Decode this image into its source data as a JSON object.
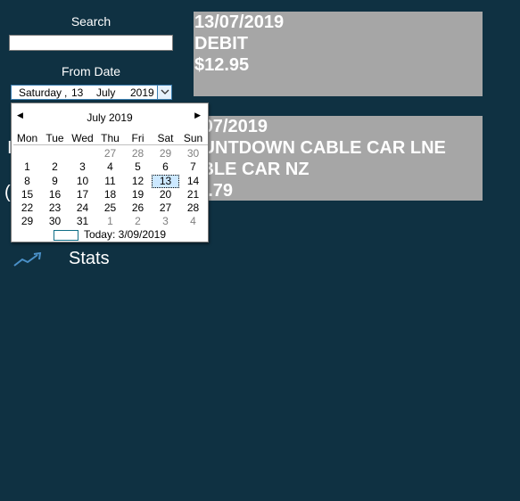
{
  "sidebar": {
    "search_label": "Search",
    "search_value": "",
    "from_date_label": "From Date",
    "date_picker": {
      "day_name": "Saturday",
      "separator": ",",
      "day": "13",
      "month": "July",
      "year": "2019"
    },
    "stats_label": "Stats",
    "hidden_fragments": [
      "I",
      "("
    ]
  },
  "calendar": {
    "month_title": "July 2019",
    "weekdays": [
      "Mon",
      "Tue",
      "Wed",
      "Thu",
      "Fri",
      "Sat",
      "Sun"
    ],
    "weeks": [
      [
        "",
        "",
        "",
        "27",
        "28",
        "29",
        "30"
      ],
      [
        "1",
        "2",
        "3",
        "4",
        "5",
        "6",
        "7"
      ],
      [
        "8",
        "9",
        "10",
        "11",
        "12",
        "13",
        "14"
      ],
      [
        "15",
        "16",
        "17",
        "18",
        "19",
        "20",
        "21"
      ],
      [
        "22",
        "23",
        "24",
        "25",
        "26",
        "27",
        "28"
      ],
      [
        "29",
        "30",
        "31",
        "1",
        "2",
        "3",
        "4"
      ]
    ],
    "selected": "13",
    "today_label": "Today: 3/09/2019"
  },
  "transactions": [
    {
      "date": "13/07/2019",
      "type": "DEBIT",
      "amount": "$12.95"
    },
    {
      "date": "3/07/2019",
      "desc1": "OUNTDOWN CABLE CAR LNE",
      "desc2": "ABLE CAR NZ",
      "amount": "22.79"
    }
  ],
  "colors": {
    "background": "#0f3142",
    "card": "#a6a6a6",
    "accent": "#3c7fb1"
  }
}
